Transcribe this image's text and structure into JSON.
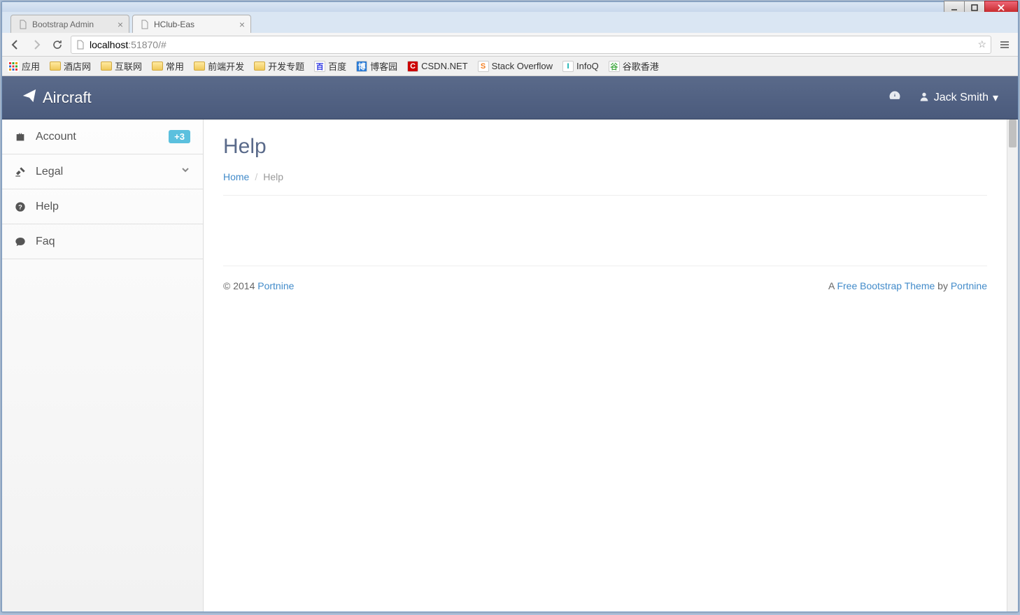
{
  "browser": {
    "tabs": [
      {
        "title": "Bootstrap Admin",
        "active": false
      },
      {
        "title": "HClub-Eas",
        "active": true
      }
    ],
    "url_host": "localhost",
    "url_port_path": ":51870/#",
    "bookmarks": [
      {
        "label": "应用",
        "type": "apps"
      },
      {
        "label": "酒店网",
        "type": "folder"
      },
      {
        "label": "互联网",
        "type": "folder"
      },
      {
        "label": "常用",
        "type": "folder"
      },
      {
        "label": "前端开发",
        "type": "folder"
      },
      {
        "label": "开发专题",
        "type": "folder"
      },
      {
        "label": "百度",
        "type": "favicon",
        "color": "#2932e1",
        "bg": "#fff"
      },
      {
        "label": "博客园",
        "type": "favicon",
        "color": "#fff",
        "bg": "#2a7bd6"
      },
      {
        "label": "CSDN.NET",
        "type": "favicon",
        "color": "#fff",
        "bg": "#c00"
      },
      {
        "label": "Stack Overflow",
        "type": "favicon",
        "color": "#f48024",
        "bg": "#fff"
      },
      {
        "label": "InfoQ",
        "type": "favicon",
        "color": "#0aa",
        "bg": "#fff"
      },
      {
        "label": "谷歌香港",
        "type": "favicon",
        "color": "#4a4",
        "bg": "#fff"
      }
    ]
  },
  "header": {
    "brand": "Aircraft",
    "user_name": "Jack Smith"
  },
  "sidebar": {
    "items": [
      {
        "icon": "briefcase",
        "label": "Account",
        "badge": "+3"
      },
      {
        "icon": "gavel",
        "label": "Legal",
        "expandable": true
      },
      {
        "icon": "question",
        "label": "Help"
      },
      {
        "icon": "comment",
        "label": "Faq"
      }
    ]
  },
  "page": {
    "title": "Help",
    "breadcrumb_home": "Home",
    "breadcrumb_current": "Help"
  },
  "footer": {
    "copyright": "© 2014 ",
    "copyright_link": "Portnine",
    "right_prefix": "A ",
    "right_link1": "Free Bootstrap Theme",
    "right_mid": " by ",
    "right_link2": "Portnine"
  }
}
